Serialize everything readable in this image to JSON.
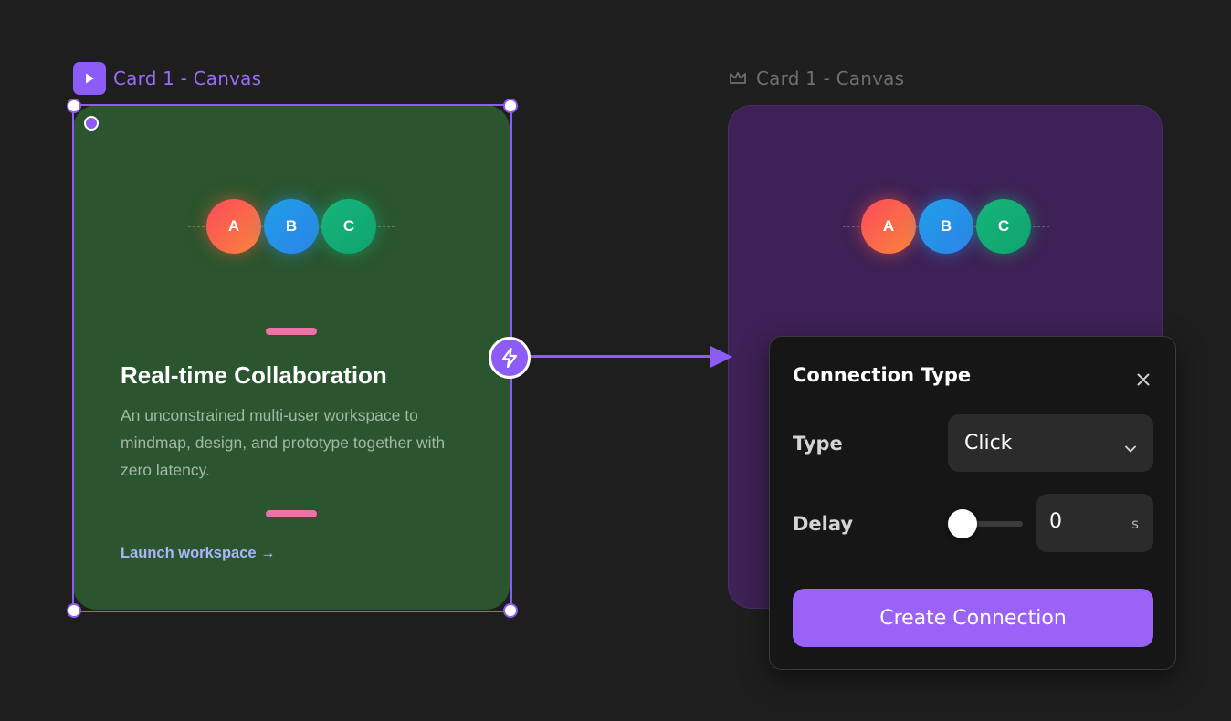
{
  "left_frame": {
    "label": "Card 1 - Canvas",
    "icon": "play-icon",
    "accent_color": "#8b5cf6"
  },
  "right_frame": {
    "label": "Card 1 - Canvas",
    "icon": "crown-icon"
  },
  "card": {
    "avatars": [
      "A",
      "B",
      "C"
    ],
    "title": "Real-time Collaboration",
    "description": "An unconstrained multi-user workspace to mindmap, design, and prototype together with zero latency.",
    "link_label": "Launch workspace →",
    "background": "#2b552e"
  },
  "target_card": {
    "avatars": [
      "A",
      "B",
      "C"
    ],
    "background": "#3e2156"
  },
  "connection_node": {
    "icon": "lightning-icon"
  },
  "dialog": {
    "title": "Connection Type",
    "close_icon": "close-icon",
    "type_label": "Type",
    "type_value": "Click",
    "delay_label": "Delay",
    "delay_value": "0",
    "delay_unit": "s",
    "delay_slider_level": 0,
    "create_label": "Create Connection",
    "button_color": "#9a62f6"
  }
}
